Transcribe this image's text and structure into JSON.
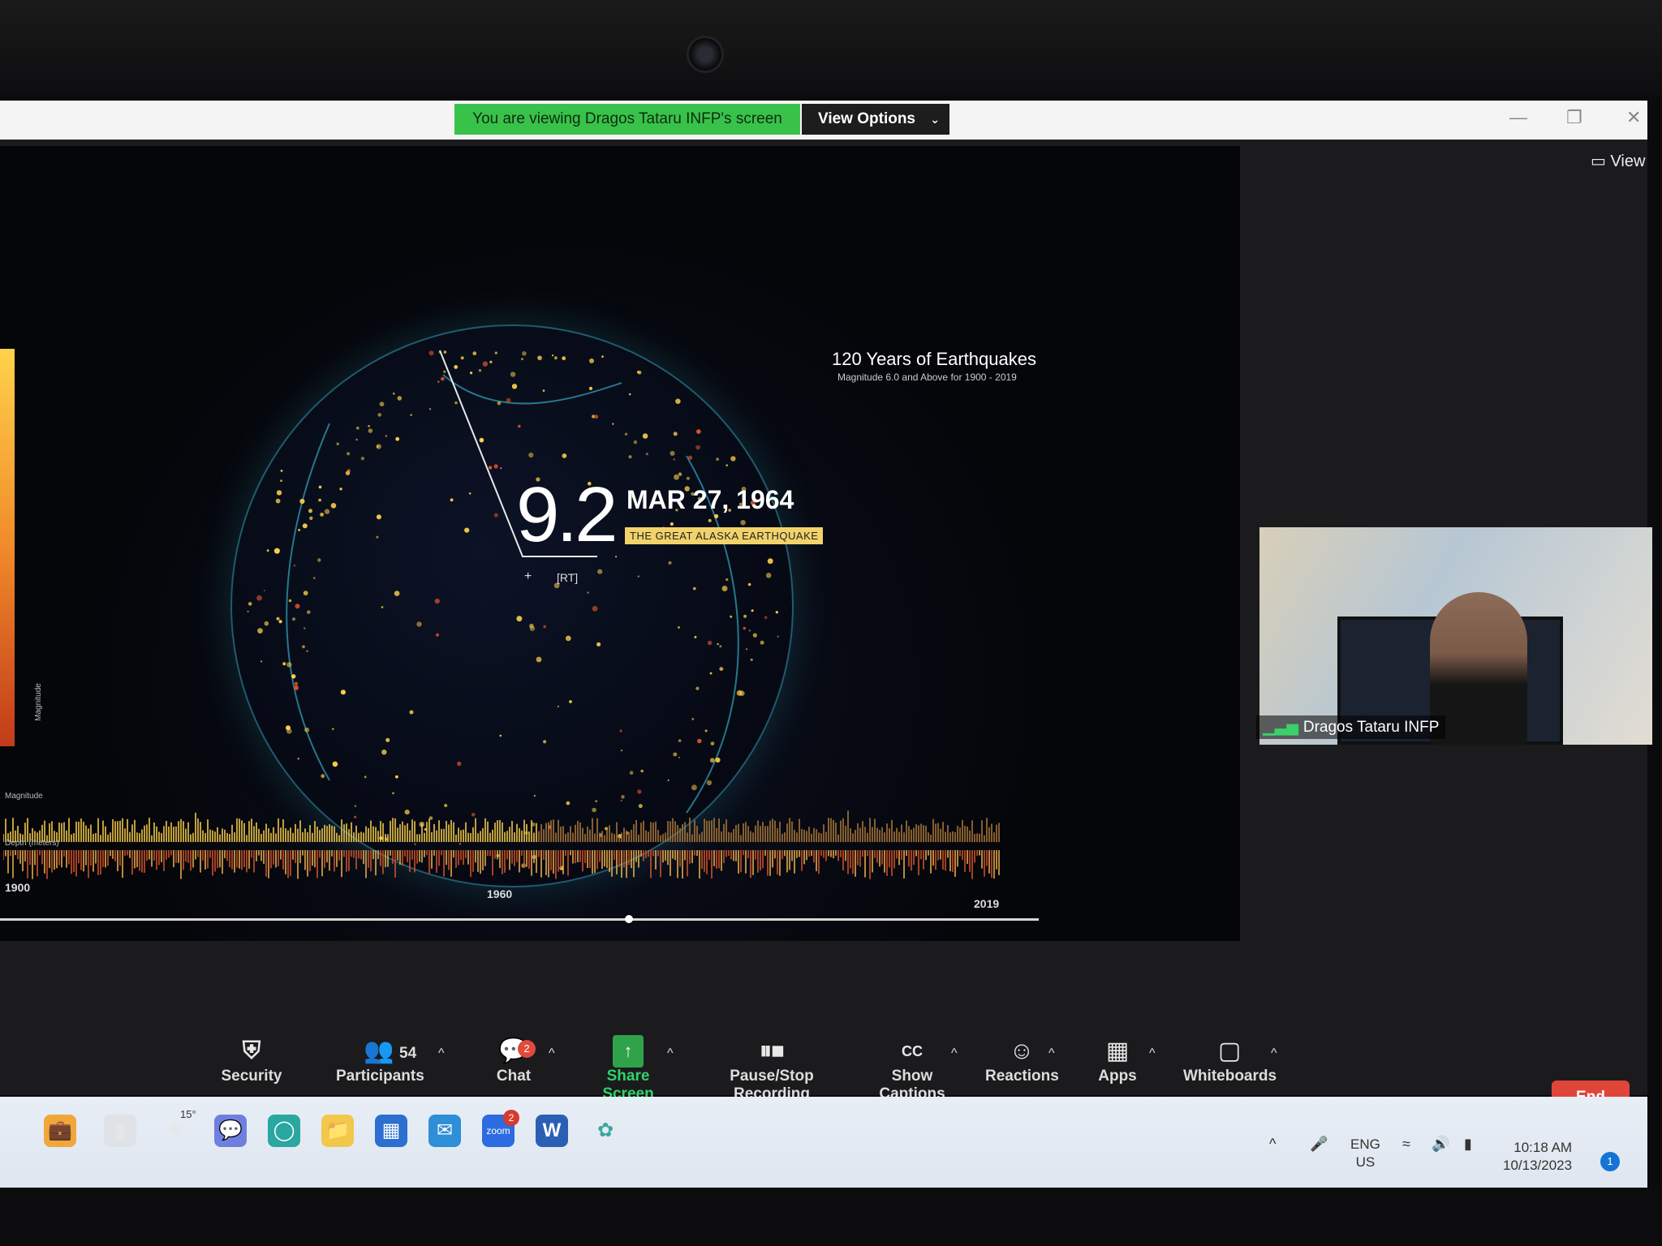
{
  "window": {
    "share_banner": "You are viewing Dragos Tataru INFP's screen",
    "view_options": "View Options",
    "view_options_chevron": "chevron-down-icon",
    "top_right_view": "View"
  },
  "shared_content": {
    "title": "120 Years of Earthquakes",
    "subtitle": "Magnitude 6.0 and Above for 1900 - 2019",
    "featured_magnitude": "9.2",
    "featured_date": "MAR 27, 1964",
    "featured_name": "THE GREAT ALASKA EARTHQUAKE",
    "rt_tag": "[RT]",
    "plus_tag": "+",
    "scale_label_magnitude": "Magnitude",
    "track_label_magnitude": "Magnitude",
    "track_label_depth": "Depth (meters)",
    "years": [
      "1900",
      "1960",
      "2019"
    ],
    "colors": {
      "quake_yellow": "#ffd24a",
      "coast_cyan": "#3cc0dc"
    }
  },
  "participant": {
    "name": "Dragos Tataru INFP"
  },
  "toolbar": {
    "security": "Security",
    "participants": "Participants",
    "participants_count": "54",
    "chat": "Chat",
    "chat_badge": "2",
    "share_screen": "Share Screen",
    "recording": "Pause/Stop Recording",
    "captions": "Show Captions",
    "captions_icon_text": "CC",
    "reactions": "Reactions",
    "apps": "Apps",
    "whiteboards": "Whiteboards",
    "end": "End",
    "accent_green": "#2fd36a",
    "end_red": "#e0453a"
  },
  "taskbar": {
    "weather": "15°",
    "zoom_badge": "2",
    "lang_top": "ENG",
    "lang_bottom": "US",
    "time": "10:18 AM",
    "date": "10/13/2023",
    "notifications": "1"
  }
}
